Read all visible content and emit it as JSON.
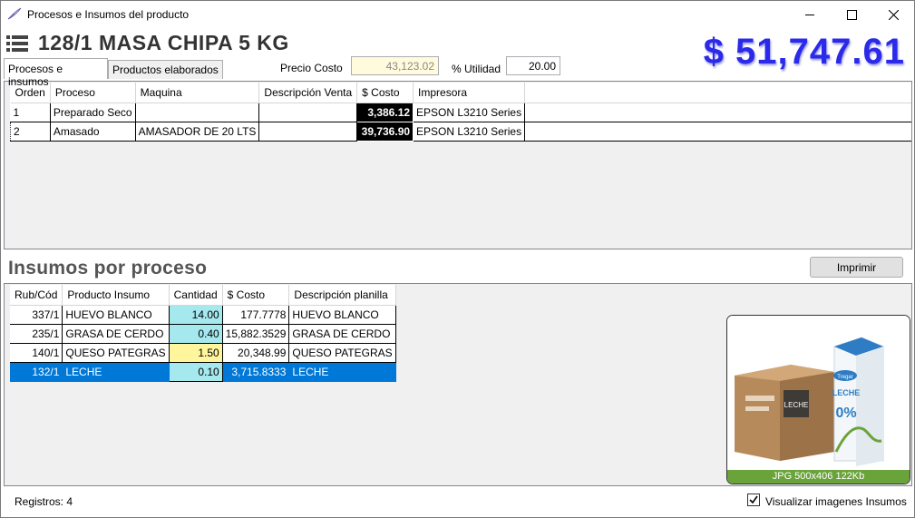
{
  "window": {
    "title": "Procesos e Insumos del producto",
    "app_icon": "feather-pen-icon"
  },
  "header": {
    "product_title": "128/1 MASA CHIPA 5 KG",
    "big_price": "$ 51,747.61",
    "price_color": "#2a2ae8"
  },
  "tabs": [
    {
      "label": "Procesos e insumos",
      "active": true
    },
    {
      "label": "Productos elaborados",
      "active": false
    }
  ],
  "fields": {
    "precio_costo_label": "Precio Costo",
    "precio_costo_value": "43,123.02",
    "utilidad_label": "% Utilidad",
    "utilidad_value": "20.00"
  },
  "procesos": {
    "columns": [
      "Orden",
      "Proceso",
      "Maquina",
      "Descripción Venta",
      "$ Costo",
      "Impresora"
    ],
    "rows": [
      {
        "orden": "1",
        "proceso": "Preparado Seco",
        "maquina": "",
        "descripcion": "",
        "costo": "3,386.12",
        "impresora": "EPSON L3210 Series"
      },
      {
        "orden": "2",
        "proceso": "Amasado",
        "maquina": "AMASADOR DE 20 LTS",
        "descripcion": "",
        "costo": "39,736.90",
        "impresora": "EPSON L3210 Series"
      }
    ]
  },
  "insumos": {
    "section_title": "Insumos por proceso",
    "print_button": "Imprimir",
    "columns": [
      "Rub/Cód",
      "Producto Insumo",
      "Cantidad",
      "$ Costo",
      "Descripción planilla"
    ],
    "rows": [
      {
        "cod": "337/1",
        "producto": "HUEVO BLANCO",
        "cantidad": "14.00",
        "costo": "177.7778",
        "descripcion": "HUEVO BLANCO"
      },
      {
        "cod": "235/1",
        "producto": "GRASA DE CERDO",
        "cantidad": "0.40",
        "costo": "15,882.3529",
        "descripcion": "GRASA DE CERDO"
      },
      {
        "cod": "140/1",
        "producto": "QUESO PATEGRAS",
        "cantidad": "1.50",
        "costo": "20,348.99",
        "descripcion": "QUESO PATEGRAS"
      },
      {
        "cod": "132/1",
        "producto": "LECHE",
        "cantidad": "0.10",
        "costo": "3,715.8333",
        "descripcion": "LECHE"
      }
    ],
    "selection_color": "#0078d7"
  },
  "image_preview": {
    "caption": "JPG 500x406 122Kb",
    "box_text": "LECHE",
    "carton_brand": "Tregar",
    "carton_text": "LECHE",
    "carton_percent": "0%"
  },
  "status": {
    "registros": "Registros: 4",
    "checkbox_label": "Visualizar imagenes Insumos",
    "checkbox_checked": true
  }
}
